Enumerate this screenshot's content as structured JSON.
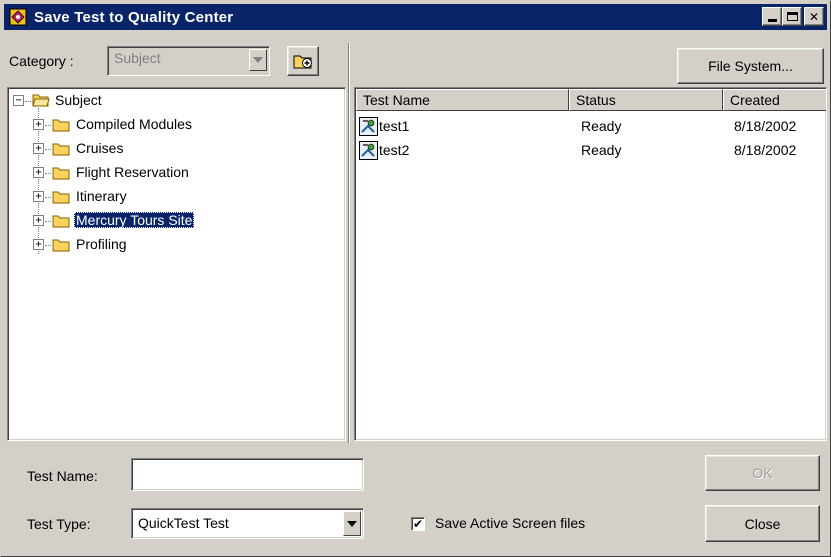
{
  "window": {
    "title": "Save Test to Quality Center",
    "icon": "quality-center-icon"
  },
  "category": {
    "label": "Category :",
    "value": "Subject"
  },
  "file_system_button": "File System...",
  "tree": {
    "root": "Subject",
    "items": [
      {
        "label": "Compiled Modules",
        "selected": false
      },
      {
        "label": "Cruises",
        "selected": false
      },
      {
        "label": "Flight Reservation",
        "selected": false
      },
      {
        "label": "Itinerary",
        "selected": false
      },
      {
        "label": "Mercury Tours Site",
        "selected": true
      },
      {
        "label": "Profiling",
        "selected": false
      }
    ]
  },
  "list": {
    "columns": [
      "Test Name",
      "Status",
      "Created"
    ],
    "rows": [
      {
        "name": "test1",
        "status": "Ready",
        "created": "8/18/2002"
      },
      {
        "name": "test2",
        "status": "Ready",
        "created": "8/18/2002"
      }
    ]
  },
  "form": {
    "test_name_label": "Test Name:",
    "test_name_value": "",
    "test_type_label": "Test Type:",
    "test_type_value": "QuickTest Test",
    "save_active_screen_label": "Save Active Screen files",
    "save_active_screen_checked": true
  },
  "buttons": {
    "ok": "OK",
    "close": "Close"
  },
  "colors": {
    "title_bar": "#0a246a",
    "face": "#d4d0c8",
    "selection": "#0a246a",
    "folder": "#f7d35a"
  }
}
